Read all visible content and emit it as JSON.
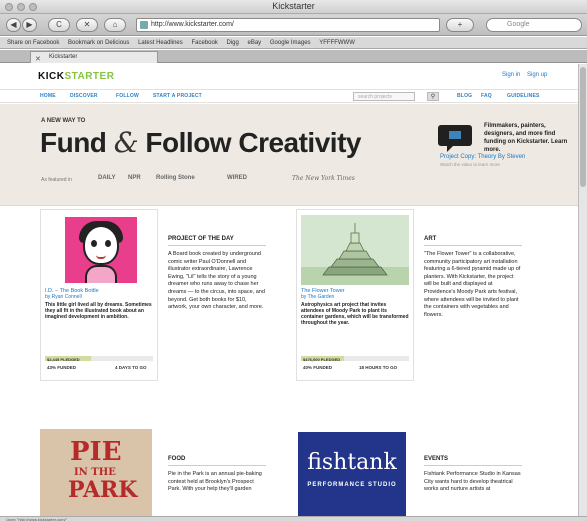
{
  "window": {
    "title": "Kickstarter"
  },
  "toolbar": {
    "back": "◀",
    "forward": "▶",
    "reload": "C",
    "stop": "✕",
    "home": "⌂",
    "url": "http://www.kickstarter.com/",
    "search_placeholder": "Google"
  },
  "bookmarks": [
    "Share on Facebook",
    "Bookmark on Delicious",
    "Latest Headlines",
    "Facebook",
    "Digg",
    "eBay",
    "Google Images",
    "YFFFFWWW"
  ],
  "tab": {
    "label": "Kickstarter",
    "close": "✕"
  },
  "site": {
    "logo_kick": "KICK",
    "logo_starter": "STARTER",
    "sign_in": "Sign in",
    "sign_up": "Sign up",
    "nav": [
      "HOME",
      "DISCOVER",
      "FOLLOW",
      "START A PROJECT"
    ],
    "nav_right": [
      "BLOG",
      "FAQ",
      "GUIDELINES"
    ],
    "search_placeholder": "search projects",
    "search_button": "⚲"
  },
  "hero": {
    "tagline": "A NEW WAY TO",
    "headline_left": "Fund",
    "headline_amp": "&",
    "headline_right": "Follow Creativity",
    "press_label": "As featured in",
    "press": [
      "DAILY",
      "NPR",
      "Rolling Stone",
      "WIRED",
      "The New York Times"
    ],
    "video_text": "Filmmakers, painters, designers, and more find funding on Kickstarter. Learn more.",
    "video_link": "Project Copy: Theory By Steven",
    "video_sub": "Watch the video to learn more"
  },
  "projects": [
    {
      "title": "I.D. – The Book Bottle",
      "by": "by Ryan Connell",
      "blurb": "This little girl lived all by dreams. Sometimes they all fit in the illustrated book about an imagined development in ambition.",
      "pledged": "$2,445 PLEDGED",
      "percent": 0.43,
      "funded": "43% FUNDED",
      "time_left": "4 DAYS TO GO",
      "section": "PROJECT OF THE DAY",
      "section_body": "A Board book created by underground comic writer Paul O'Donnell and illustrator extraordinaire, Lawrence Ewing, \"Lil\" tells the story of a young dreamer who runs away to chase her dreams — to the circus, into space, and beyond. Get both books for $10, artwork, your own character, and more."
    },
    {
      "title": "The Flower Tower",
      "by": "by The Garden",
      "blurb": "Astrophysics art project that invites attendees of Moody Park to plant its container gardens, which will be transformed throughout the year.",
      "pledged": "$476,000 PLEDGED",
      "percent": 0.4,
      "funded": "40% FUNDED",
      "time_left": "18 HOURS TO GO",
      "section": "ART",
      "section_body": "\"The Flower Tower\" is a collaborative, community participatory art installation featuring a 6-tiered pyramid made up of planters. With Kickstarter, the project will be built and displayed at Providence's Moody Park arts festival, where attendees will be invited to plant the containers with vegetables and flowers."
    },
    {
      "img_line1": "PIE",
      "img_line2": "IN THE",
      "img_line3": "PARK",
      "section": "FOOD",
      "section_body": "Pie in the Park is an annual pie-baking contest held at Brooklyn's Prospect Park. With your help they'll garden"
    },
    {
      "img_word": "fishtank",
      "img_sub": "PERFORMANCE STUDIO",
      "section": "EVENTS",
      "section_body": "Fishtank Performance Studio in Kansas City wants hard to develop theatrical works and nurture artists at"
    }
  ],
  "status_bar": "Open \"http://www.kickstarter.com/\""
}
